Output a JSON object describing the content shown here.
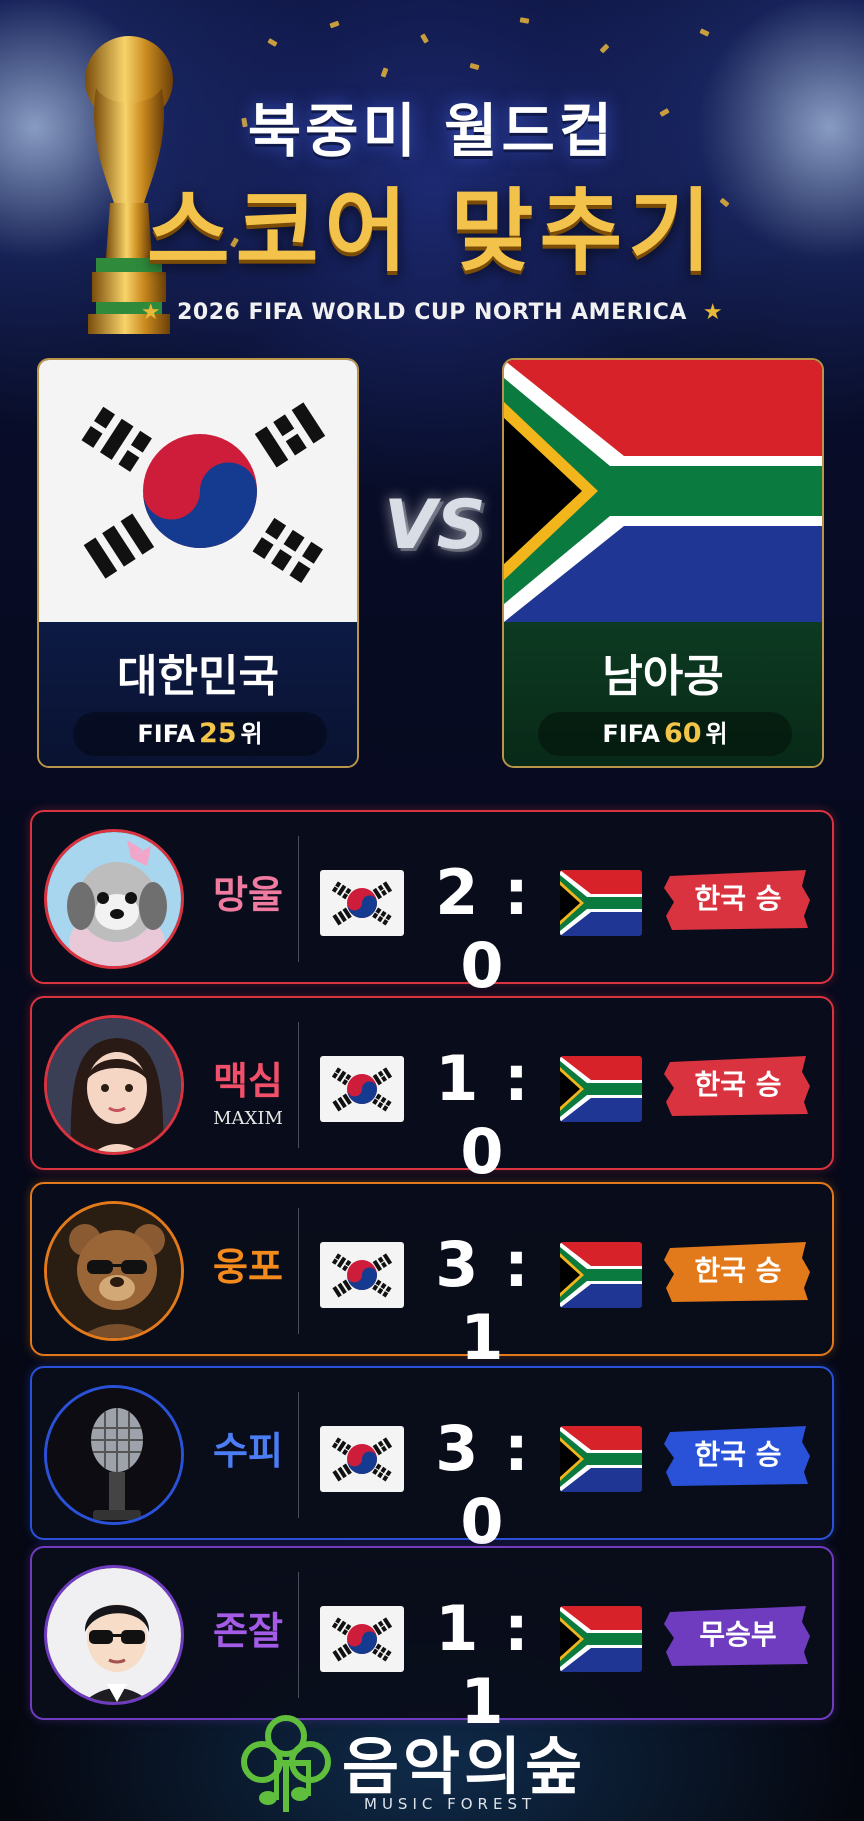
{
  "header": {
    "title_line1": "북중미 월드컵",
    "title_line2": "스코어 맞추기",
    "subtitle": "2026 FIFA WORLD CUP NORTH AMERICA"
  },
  "teams": [
    {
      "name": "대한민국",
      "rank_prefix": "FIFA",
      "rank": "25",
      "rank_suffix": "위"
    },
    {
      "name": "남아공",
      "rank_prefix": "FIFA",
      "rank": "60",
      "rank_suffix": "위"
    }
  ],
  "vs_label": "VS",
  "predictions": [
    {
      "name": "망울",
      "tag": "",
      "home": "2",
      "away": "0",
      "result": "한국 승",
      "name_color": "#f07ba0",
      "accent": "#d9333f",
      "avatar": "dog-avatar"
    },
    {
      "name": "맥심",
      "tag": "MAXIM",
      "home": "1",
      "away": "0",
      "result": "한국 승",
      "name_color": "#f0506a",
      "accent": "#d9333f",
      "avatar": "woman-avatar"
    },
    {
      "name": "웅포",
      "tag": "",
      "home": "3",
      "away": "1",
      "result": "한국 승",
      "name_color": "#f28a1e",
      "accent": "#e2791a",
      "avatar": "bear-avatar"
    },
    {
      "name": "수피",
      "tag": "",
      "home": "3",
      "away": "0",
      "result": "한국 승",
      "name_color": "#4c7df5",
      "accent": "#2a52d8",
      "avatar": "microphone-avatar"
    },
    {
      "name": "존잘",
      "tag": "",
      "home": "1",
      "away": "1",
      "result": "무승부",
      "name_color": "#a45be6",
      "accent": "#6f3cc0",
      "avatar": "man-avatar"
    }
  ],
  "score_separator": ":",
  "footer": {
    "logo_text": "음악의숲",
    "logo_sub": "MUSIC FOREST"
  }
}
